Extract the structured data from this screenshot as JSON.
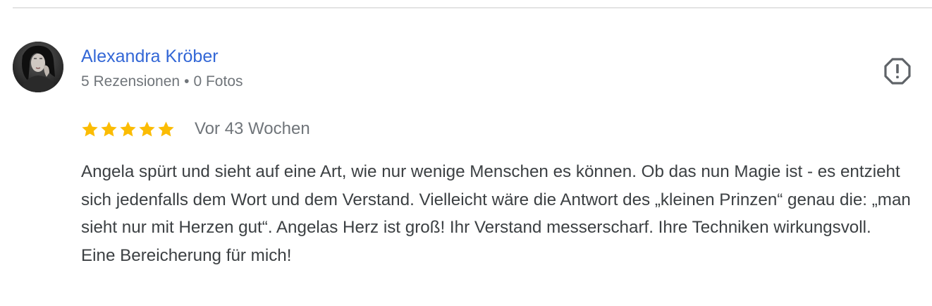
{
  "review": {
    "author_name": "Alexandra Kröber",
    "reviews_count": "5 Rezensionen",
    "separator": "•",
    "photos_count": "0 Fotos",
    "rating": 5,
    "rating_max": 5,
    "star_color": "#fbbc04",
    "time_ago": "Vor 43 Wochen",
    "text": "Angela spürt und sieht auf eine Art, wie nur wenige Menschen es können. Ob das nun Magie ist - es entzieht sich jedenfalls dem Wort und dem Verstand. Vielleicht wäre die Antwort des „kleinen Prinzen“ genau die: „man sieht nur mit Herzen gut“. Angelas Herz ist groß! Ihr Verstand messerscharf. Ihre Techniken wirkungsvoll.\nEine Bereicherung für mich!",
    "report_icon": "report-flag-octagon-icon",
    "author_color": "#3367d6"
  }
}
